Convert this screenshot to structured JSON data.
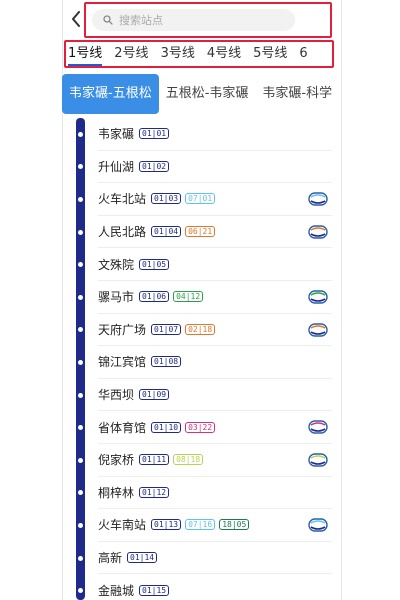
{
  "search": {
    "placeholder": "搜索站点",
    "back_icon": "chevron-left-icon",
    "search_icon": "search-icon"
  },
  "line_tabs": [
    {
      "label": "1号线",
      "active": true
    },
    {
      "label": "2号线",
      "active": false
    },
    {
      "label": "3号线",
      "active": false
    },
    {
      "label": "4号线",
      "active": false
    },
    {
      "label": "5号线",
      "active": false
    },
    {
      "label": "6",
      "active": false
    }
  ],
  "direction_tabs": [
    {
      "label": "韦家碾-五根松",
      "active": true
    },
    {
      "label": "五根松-韦家碾",
      "active": false
    },
    {
      "label": "韦家碾-科学",
      "active": false
    }
  ],
  "colors": {
    "line1": "#1f2a8a",
    "line2": "#e0762b",
    "line3": "#d6307a",
    "line4": "#2aa14a",
    "line5": "#c4278f",
    "line7": "#62c3ea",
    "line18": "#1d7a4f",
    "line6": "#b7d553",
    "accent": "#3a8ee6",
    "highlight": "#e2203e"
  },
  "stations": [
    {
      "name": "韦家碾",
      "codes": [
        {
          "text": "01|01",
          "color": "#1f2a8a"
        }
      ],
      "transfer": false
    },
    {
      "name": "升仙湖",
      "codes": [
        {
          "text": "01|02",
          "color": "#1f2a8a"
        }
      ],
      "transfer": false
    },
    {
      "name": "火车北站",
      "codes": [
        {
          "text": "01|03",
          "color": "#1f2a8a"
        },
        {
          "text": "07|01",
          "color": "#62c3ea"
        }
      ],
      "transfer": true
    },
    {
      "name": "人民北路",
      "codes": [
        {
          "text": "01|04",
          "color": "#1f2a8a"
        },
        {
          "text": "06|21",
          "color": "#e0762b"
        }
      ],
      "transfer": true
    },
    {
      "name": "文殊院",
      "codes": [
        {
          "text": "01|05",
          "color": "#1f2a8a"
        }
      ],
      "transfer": false
    },
    {
      "name": "骡马市",
      "codes": [
        {
          "text": "01|06",
          "color": "#1f2a8a"
        },
        {
          "text": "04|12",
          "color": "#2aa14a"
        }
      ],
      "transfer": true
    },
    {
      "name": "天府广场",
      "codes": [
        {
          "text": "01|07",
          "color": "#1f2a8a"
        },
        {
          "text": "02|18",
          "color": "#e0762b"
        }
      ],
      "transfer": true
    },
    {
      "name": "锦江宾馆",
      "codes": [
        {
          "text": "01|08",
          "color": "#1f2a8a"
        }
      ],
      "transfer": false
    },
    {
      "name": "华西坝",
      "codes": [
        {
          "text": "01|09",
          "color": "#1f2a8a"
        }
      ],
      "transfer": false
    },
    {
      "name": "省体育馆",
      "codes": [
        {
          "text": "01|10",
          "color": "#1f2a8a"
        },
        {
          "text": "03|22",
          "color": "#d6307a"
        }
      ],
      "transfer": true
    },
    {
      "name": "倪家桥",
      "codes": [
        {
          "text": "01|11",
          "color": "#1f2a8a"
        },
        {
          "text": "08|18",
          "color": "#b7d553"
        }
      ],
      "transfer": true
    },
    {
      "name": "桐梓林",
      "codes": [
        {
          "text": "01|12",
          "color": "#1f2a8a"
        }
      ],
      "transfer": false
    },
    {
      "name": "火车南站",
      "codes": [
        {
          "text": "01|13",
          "color": "#1f2a8a"
        },
        {
          "text": "07|16",
          "color": "#62c3ea"
        },
        {
          "text": "18|05",
          "color": "#1d7a4f"
        }
      ],
      "transfer": true
    },
    {
      "name": "高新",
      "codes": [
        {
          "text": "01|14",
          "color": "#1f2a8a"
        }
      ],
      "transfer": false
    },
    {
      "name": "金融城",
      "codes": [
        {
          "text": "01|15",
          "color": "#1f2a8a"
        }
      ],
      "transfer": false
    }
  ]
}
